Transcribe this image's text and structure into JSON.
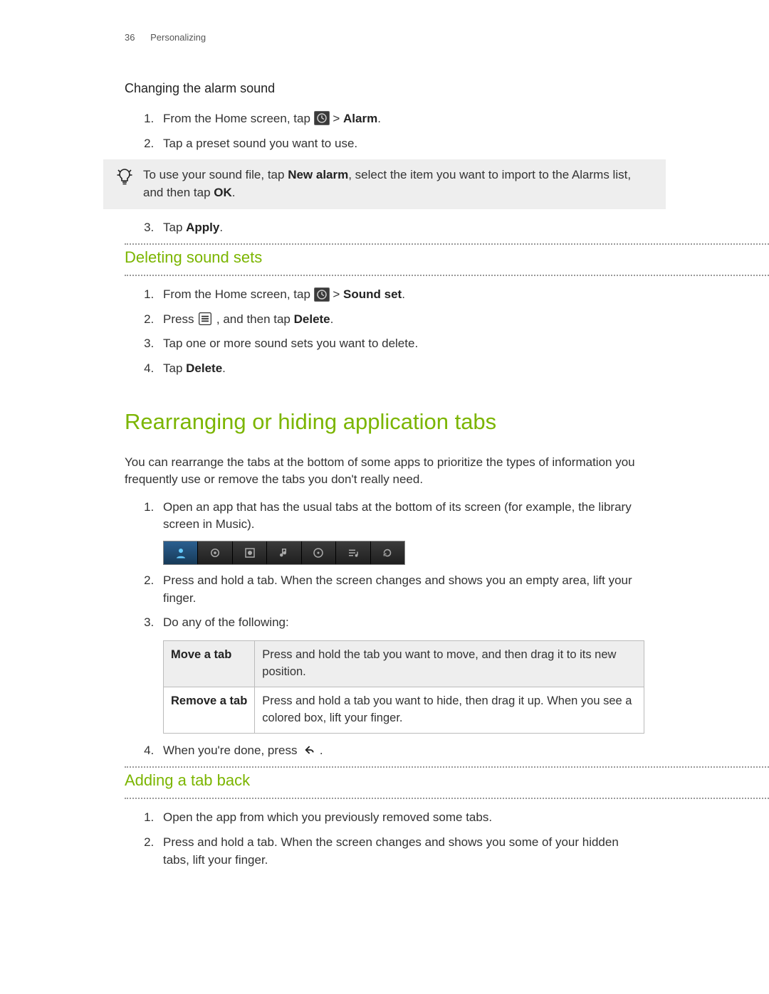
{
  "header": {
    "page_number": "36",
    "section": "Personalizing"
  },
  "sec1": {
    "title": "Changing the alarm sound",
    "step1_a": "From the Home screen, tap ",
    "step1_b": " > ",
    "step1_c": "Alarm",
    "step1_d": ".",
    "step2": "Tap a preset sound you want to use.",
    "tip_a": "To use your sound file, tap ",
    "tip_b": "New alarm",
    "tip_c": ", select the item you want to import to the Alarms list, and then tap ",
    "tip_d": "OK",
    "tip_e": ".",
    "step3_a": "Tap ",
    "step3_b": "Apply",
    "step3_c": "."
  },
  "sec2": {
    "title": "Deleting sound sets",
    "s1_a": "From the Home screen, tap ",
    "s1_b": " > ",
    "s1_c": "Sound set",
    "s1_d": ".",
    "s2_a": "Press ",
    "s2_b": " , and then tap ",
    "s2_c": "Delete",
    "s2_d": ".",
    "s3": "Tap one or more sound sets you want to delete.",
    "s4_a": "Tap ",
    "s4_b": "Delete",
    "s4_c": "."
  },
  "sec3": {
    "title": "Rearranging or hiding application tabs",
    "intro": "You can rearrange the tabs at the bottom of some apps to prioritize the types of information you frequently use or remove the tabs you don't really need.",
    "s1": "Open an app that has the usual tabs at the bottom of its screen (for example, the library screen in Music).",
    "s2": "Press and hold a tab. When the screen changes and shows you an empty area, lift your finger.",
    "s3": "Do any of the following:",
    "tbl_r1_term": "Move a tab",
    "tbl_r1_def": "Press and hold the tab you want to move, and then drag it to its new position.",
    "tbl_r2_term": "Remove a tab",
    "tbl_r2_def": "Press and hold a tab you want to hide, then drag it up. When you see a colored box, lift your finger.",
    "s4_a": "When you're done, press ",
    "s4_b": " ."
  },
  "sec4": {
    "title": "Adding a tab back",
    "s1": "Open the app from which you previously removed some tabs.",
    "s2": "Press and hold a tab. When the screen changes and shows you some of your hidden tabs, lift your finger."
  }
}
